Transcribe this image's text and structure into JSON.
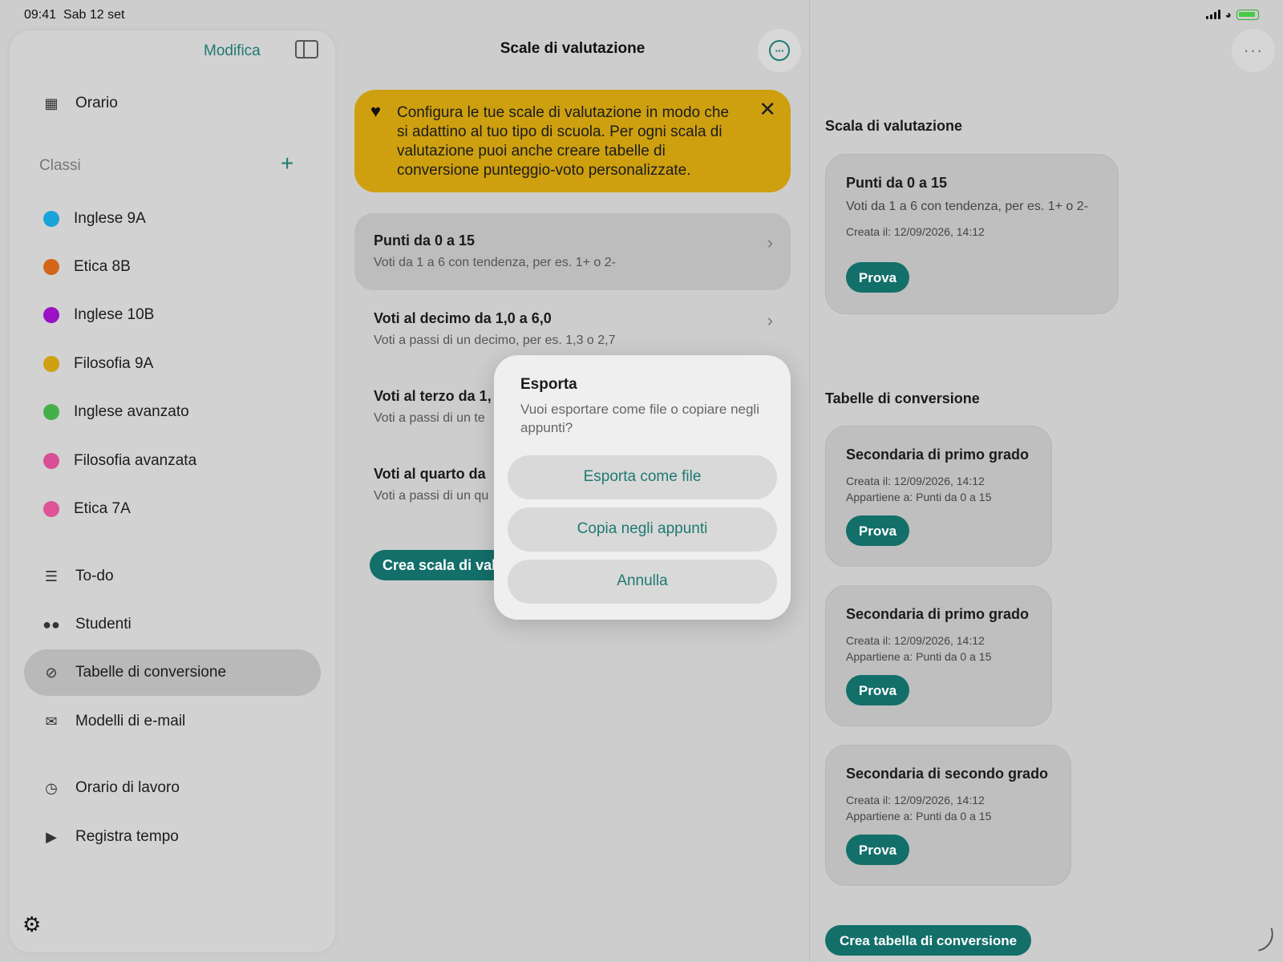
{
  "status_bar": {
    "time": "09:41",
    "date": "Sab 12 set"
  },
  "sidebar": {
    "edit_label": "Modifica",
    "schedule_label": "Orario",
    "classes_header": "Classi",
    "classes": [
      {
        "label": "Inglese 9A",
        "color": "#1aa3d9"
      },
      {
        "label": "Etica 8B",
        "color": "#d2651a"
      },
      {
        "label": "Inglese 10B",
        "color": "#9a12c4"
      },
      {
        "label": "Filosofia 9A",
        "color": "#cfa010"
      },
      {
        "label": "Inglese avanzato",
        "color": "#45b04a"
      },
      {
        "label": "Filosofia avanzata",
        "color": "#d84f96"
      },
      {
        "label": "Etica 7A",
        "color": "#dd5596"
      }
    ],
    "items": [
      {
        "label": "To-do",
        "icon": "checklist-icon"
      },
      {
        "label": "Studenti",
        "icon": "people-icon"
      },
      {
        "label": "Tabelle di conversione",
        "icon": "conversion-icon"
      },
      {
        "label": "Modelli di e-mail",
        "icon": "envelope-icon"
      },
      {
        "label": "Orario di lavoro",
        "icon": "clock-icon"
      },
      {
        "label": "Registra tempo",
        "icon": "play-icon"
      }
    ]
  },
  "main": {
    "title": "Scale di valutazione",
    "banner_text": "Configura le tue scale di valutazione in modo che si adattino al tuo tipo di scuola. Per ogni scala di valutazione puoi anche creare tabelle di conversione punteggio-voto personalizzate.",
    "scales": [
      {
        "title": "Punti da 0 a 15",
        "subtitle": "Voti da 1 a 6 con tendenza, per es. 1+ o 2-"
      },
      {
        "title": "Voti al decimo da 1,0 a 6,0",
        "subtitle": "Voti a passi di un decimo, per es. 1,3 o 2,7"
      },
      {
        "title": "Voti al terzo da 1,",
        "subtitle": "Voti a passi di un te"
      },
      {
        "title": "Voti al quarto da",
        "subtitle": "Voti a passi di un qu"
      }
    ],
    "create_scale_label": "Crea scala di valu"
  },
  "dialog": {
    "title": "Esporta",
    "message": "Vuoi esportare come file o copiare negli appunti?",
    "export_file": "Esporta come file",
    "copy_clipboard": "Copia negli appunti",
    "cancel": "Annulla"
  },
  "detail": {
    "scale_header": "Scala di valutazione",
    "scale_card": {
      "title": "Punti da 0 a 15",
      "subtitle": "Voti da 1 a 6 con tendenza, per es. 1+ o 2-",
      "created": "Creata il: 12/09/2026, 14:12",
      "try_label": "Prova"
    },
    "tables_header": "Tabelle di conversione",
    "tables": [
      {
        "title": "Secondaria di primo grado",
        "created": "Creata il: 12/09/2026, 14:12",
        "belongs": "Appartiene a: Punti da 0 a 15",
        "try_label": "Prova"
      },
      {
        "title": "Secondaria di primo grado",
        "created": "Creata il: 12/09/2026, 14:12",
        "belongs": "Appartiene a: Punti da 0 a 15",
        "try_label": "Prova"
      },
      {
        "title": "Secondaria di secondo grado",
        "created": "Creata il: 12/09/2026, 14:12",
        "belongs": "Appartiene a: Punti da 0 a 15",
        "try_label": "Prova"
      }
    ],
    "create_table_label": "Crea tabella di conversione"
  },
  "colors": {
    "accent": "#1f7a72",
    "button": "#136f6a",
    "banner": "#cea010"
  }
}
